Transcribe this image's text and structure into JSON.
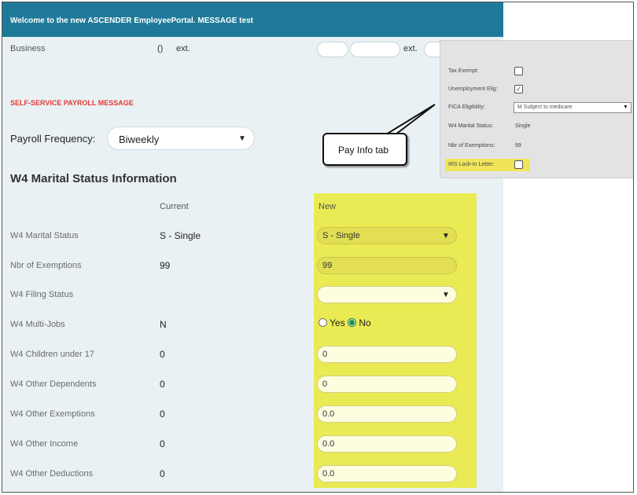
{
  "banner": {
    "text": "Welcome to the new ASCENDER EmployeePortal. MESSAGE test"
  },
  "business": {
    "label": "Business",
    "paren": "()",
    "ext1": "ext.",
    "ext2": "ext."
  },
  "payroll_message": "SELF-SERVICE PAYROLL MESSAGE",
  "payroll_frequency": {
    "label": "Payroll Frequency:",
    "value": "Biweekly"
  },
  "w4": {
    "title": "W4 Marital Status Information",
    "col_current": "Current",
    "col_new": "New",
    "rows": [
      {
        "label": "W4 Marital Status",
        "current": "S - Single",
        "new": "S - Single"
      },
      {
        "label": "Nbr of Exemptions",
        "current": "99",
        "new": "99"
      },
      {
        "label": "W4 Filing Status",
        "current": "",
        "new": ""
      },
      {
        "label": "W4 Multi-Jobs",
        "current": "N",
        "new": ""
      },
      {
        "label": "W4 Children under 17",
        "current": "0",
        "new": "0"
      },
      {
        "label": "W4 Other Dependents",
        "current": "0",
        "new": "0"
      },
      {
        "label": "W4 Other Exemptions",
        "current": "0",
        "new": "0.0"
      },
      {
        "label": "W4 Other Income",
        "current": "0",
        "new": "0.0"
      },
      {
        "label": "W4 Other Deductions",
        "current": "0",
        "new": "0.0"
      }
    ],
    "multi_jobs": {
      "yes": "Yes",
      "no": "No",
      "selected": "No"
    }
  },
  "pay_info": {
    "tax_exempt": "Tax Exempt:",
    "unemployment": "Unemployment Elig:",
    "fica": "FICA Eligibility:",
    "fica_value": "M Subject to medicare",
    "marital": "W4 Marital Status:",
    "marital_value": "Single",
    "exemptions": "Nbr of Exemptions:",
    "exemptions_value": "99",
    "irs": "IRS Lock-In Letter:",
    "unemployment_checked": true,
    "tax_exempt_checked": false,
    "irs_checked": false
  },
  "callout": "Pay Info tab",
  "colors": {
    "banner": "#1f7a99",
    "highlight": "#eaea54",
    "message": "#e53935"
  }
}
